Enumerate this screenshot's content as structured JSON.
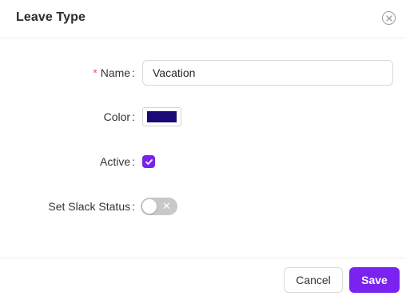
{
  "dialog": {
    "title": "Leave Type",
    "close_icon": "close-circle-icon"
  },
  "form": {
    "name": {
      "label": "Name",
      "required_mark": "*",
      "value": "Vacation"
    },
    "color": {
      "label": "Color",
      "value": "#1a0a78"
    },
    "active": {
      "label": "Active",
      "checked": true,
      "check_icon": "checkmark-icon"
    },
    "slack_status": {
      "label": "Set Slack Status",
      "enabled": false,
      "off_glyph": "✕"
    }
  },
  "footer": {
    "cancel_label": "Cancel",
    "save_label": "Save"
  },
  "colors": {
    "accent": "#7a22f0",
    "required": "#ff4d4f",
    "switch_off": "#c8c8c8"
  }
}
